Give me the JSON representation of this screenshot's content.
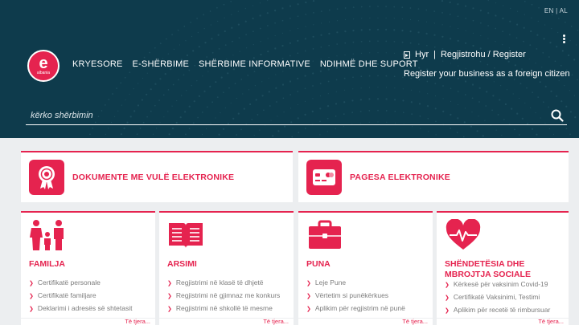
{
  "header": {
    "lang": {
      "en": "EN",
      "sep": "|",
      "al": "AL"
    },
    "logo": {
      "letter": "e",
      "tagline": "albania"
    },
    "nav": [
      "KRYESORE",
      "E-SHËRBIME",
      "SHËRBIME INFORMATIVE",
      "NDIHMË DHE SUPORT"
    ],
    "auth": {
      "login": "Hyr",
      "sep": "|",
      "register": "Regjistrohu / Register"
    },
    "foreign": "Register your business as a foreign citizen",
    "search": {
      "placeholder": "kërko shërbimin"
    }
  },
  "featured": [
    {
      "label": "DOKUMENTE ME VULË ELEKTRONIKE",
      "icon": "certificate-badge-icon"
    },
    {
      "label": "PAGESA ELEKTRONIKE",
      "icon": "credit-card-icon"
    }
  ],
  "categories": [
    {
      "title": "FAMILJA",
      "icon": "family-icon",
      "items": [
        "Certifikatë personale",
        "Certifikatë familjare",
        "Deklarimi i adresës së shtetasit"
      ],
      "more": "Të tjera..."
    },
    {
      "title": "ARSIMI",
      "icon": "open-book-icon",
      "items": [
        "Regjistrimi në klasë të dhjetë",
        "Regjistrimi në gjimnaz me konkurs",
        "Regjistrimi në shkollë të mesme"
      ],
      "more": "Të tjera..."
    },
    {
      "title": "PUNA",
      "icon": "briefcase-icon",
      "items": [
        "Leje Pune",
        "Vërtetim si punëkërkues",
        "Aplikim për regjistrim në punë"
      ],
      "more": "Të tjera..."
    },
    {
      "title": "SHËNDETËSIA DHE MBROJTJA SOCIALE",
      "icon": "heart-pulse-icon",
      "items": [
        "Kërkesë për vaksinim Covid-19",
        "Certifikatë Vaksinimi, Testimi",
        "Aplikim për recetë të rimbursuar"
      ],
      "more": "Të tjera..."
    }
  ],
  "colors": {
    "accent": "#e5234f",
    "hero": "#0e3b4c",
    "page": "#eceef0"
  }
}
